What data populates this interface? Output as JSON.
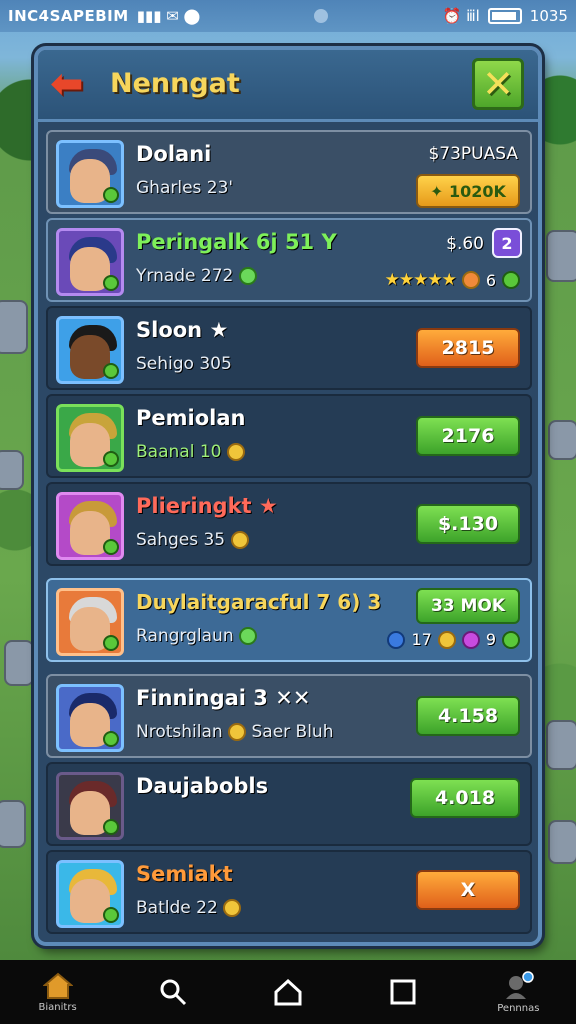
{
  "status_bar": {
    "carrier": "INC4SAPEBIM",
    "signal_icons": "▮▮▮ ✉ ⬤",
    "right_icons": "⏰ ⅲl",
    "time": "1035"
  },
  "header": {
    "title": "Nenngat"
  },
  "rows": [
    {
      "name": "Dolani",
      "sub": "Gharles 23'",
      "right_label": "$73PUASA",
      "button": "✦ 1020K",
      "name_color": "#ffffff",
      "avatar_bg": "#3b7fc4",
      "hair_color": "#3a4a7a"
    },
    {
      "name": "Peringalk 6j 51 Y",
      "sub": "Yrnade 272",
      "right_label": "$.60",
      "meta_count": "6",
      "badge": "2",
      "name_color": "#7ef05a",
      "avatar_bg": "#6a4ab8",
      "hair_color": "#2a3a8a"
    },
    {
      "name": "Sloon ★",
      "sub": "Sehigo 305",
      "button": "2815",
      "name_color": "#ffffff",
      "avatar_bg": "#3ea0e8",
      "hair_color": "#1a1a1a"
    },
    {
      "name": "Pemiolan",
      "sub": "Baanal 10",
      "button": "2176",
      "name_color": "#ffffff",
      "avatar_bg": "#3aa848",
      "hair_color": "#c8a43a"
    },
    {
      "name": "Plieringkt ★",
      "sub": "Sahges 35",
      "button": "$.130",
      "name_color": "#ff6a5a",
      "avatar_bg": "#b44ac8",
      "hair_color": "#c89a3a"
    },
    {
      "name": "Duylaitgaracful 7 6) 3",
      "sub": "Rangrglaun",
      "button": "33 MOK",
      "meta_a": "17",
      "meta_b": "9",
      "name_color": "#f7d65c",
      "avatar_bg": "#e87a3a",
      "hair_color": "#d8d8d8"
    },
    {
      "name": "Finningai 3 ✕✕",
      "sub": "Nrotshilan",
      "sub2": "Saer Bluh",
      "button": "4.158",
      "name_color": "#ffffff",
      "avatar_bg": "#4a6ac8",
      "hair_color": "#1a2a6a"
    },
    {
      "name": "Daujabobls",
      "sub": "",
      "button": "4.018",
      "name_color": "#ffffff",
      "avatar_bg": "#3a3a4a",
      "hair_color": "#6a2a2a"
    },
    {
      "name": "Semiakt",
      "sub": "Batlde 22",
      "button": "X",
      "name_color": "#ff9a3a",
      "avatar_bg": "#3ab8e8",
      "hair_color": "#e8b83a"
    }
  ],
  "nav": {
    "home_label": "Bianitrs",
    "profile_label": "Pennnas"
  },
  "colors": {
    "panel_bg": "#2c4866",
    "accent_gold": "#f7d65c",
    "button_green": "#4ea62a",
    "button_orange": "#e0601a"
  }
}
